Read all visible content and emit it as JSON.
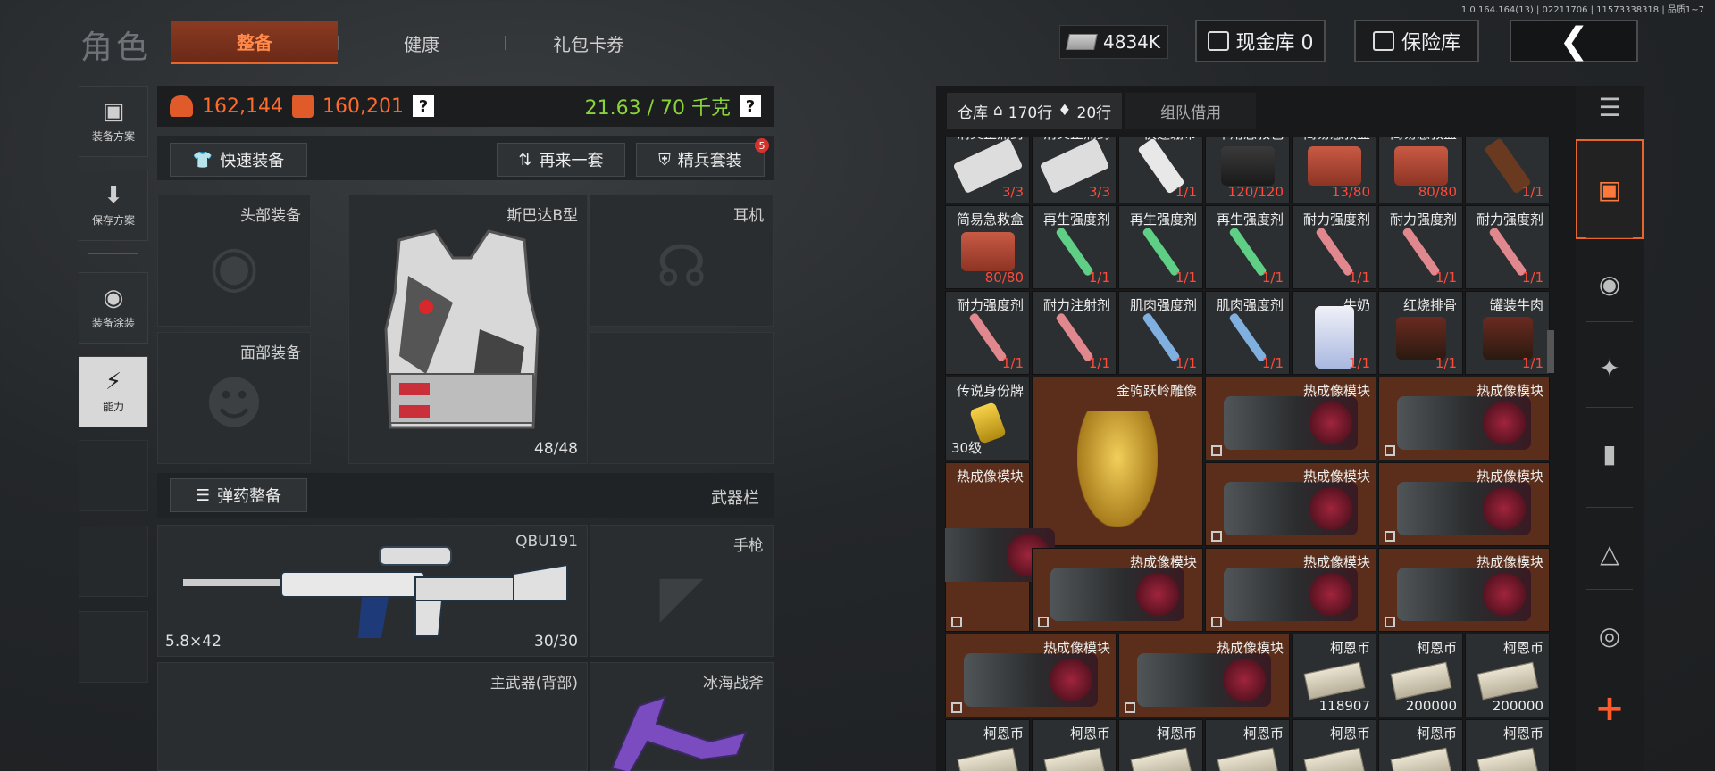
{
  "version": "1.0.164.164(13) | 02211706 | 11573338318 | 品质1~7",
  "header": {
    "title": "角色",
    "tabs": [
      {
        "label": "整备",
        "active": true
      },
      {
        "label": "健康",
        "active": false
      },
      {
        "label": "礼包卡券",
        "active": false
      }
    ],
    "money": "4834K",
    "cash_vault": "现金库 0",
    "safebox": "保险库",
    "back_icon": "chevron-left-icon"
  },
  "rail": {
    "items": [
      {
        "label": "装备方案",
        "icon": "vest-icon"
      },
      {
        "label": "保存方案",
        "icon": "download-icon"
      },
      {
        "label": "装备涂装",
        "icon": "helmet-icon"
      },
      {
        "label": "能力",
        "icon": "lightning-icon",
        "active": true
      }
    ]
  },
  "loadout": {
    "helmet_value": "162,144",
    "armor_value": "160,201",
    "weight": "21.63 / 70 千克",
    "help": "?",
    "quick_equip": "快速装备",
    "again": "再来一套",
    "elite": "精兵套装",
    "elite_badge": "5",
    "ammo_equip": "弹药整备",
    "weapon_bar": "武器栏",
    "slots": {
      "head": "头部装备",
      "face": "面部装备",
      "armor_name": "斯巴达B型",
      "armor_durability": "48/48",
      "headset": "耳机",
      "rifle_name": "QBU191",
      "rifle_caliber": "5.8×42",
      "rifle_ammo": "30/30",
      "pistol": "手枪",
      "primary_back": "主武器(背部)",
      "melee": "冰海战斧"
    }
  },
  "stash": {
    "tab_label": "仓库",
    "rows_a": "170行",
    "rows_b": "20行",
    "team_borrow": "组队借用",
    "colors": {
      "brown": "#5a2e1a",
      "cell": "#2c2f31",
      "red_qty": "#ff4a3a"
    },
    "items": [
      {
        "name": "消炎止痛药",
        "qty": "3/3",
        "red": true,
        "icon": "pills"
      },
      {
        "name": "消炎止痛药",
        "qty": "3/3",
        "red": true,
        "icon": "pills"
      },
      {
        "name": "快速绷带",
        "qty": "1/1",
        "red": true,
        "icon": "bandage"
      },
      {
        "name": "军用急救包",
        "qty": "120/120",
        "red": true,
        "icon": "medkit"
      },
      {
        "name": "简易急救盒",
        "qty": "13/80",
        "red": true,
        "icon": "medbox"
      },
      {
        "name": "简易急救盒",
        "qty": "80/80",
        "red": true,
        "icon": "medbox"
      },
      {
        "name": "",
        "qty": "1/1",
        "red": true,
        "icon": "splint"
      },
      {
        "name": "简易急救盒",
        "qty": "80/80",
        "red": true,
        "icon": "medbox"
      },
      {
        "name": "再生强度剂",
        "qty": "1/1",
        "red": true,
        "icon": "syringe-green"
      },
      {
        "name": "再生强度剂",
        "qty": "1/1",
        "red": true,
        "icon": "syringe-green"
      },
      {
        "name": "再生强度剂",
        "qty": "1/1",
        "red": true,
        "icon": "syringe-green"
      },
      {
        "name": "耐力强度剂",
        "qty": "1/1",
        "red": true,
        "icon": "syringe-pink"
      },
      {
        "name": "耐力强度剂",
        "qty": "1/1",
        "red": true,
        "icon": "syringe-pink"
      },
      {
        "name": "耐力强度剂",
        "qty": "1/1",
        "red": true,
        "icon": "syringe-pink"
      },
      {
        "name": "耐力强度剂",
        "qty": "1/1",
        "red": true,
        "icon": "syringe-pink"
      },
      {
        "name": "耐力注射剂",
        "qty": "1/1",
        "red": true,
        "icon": "syringe-pink"
      },
      {
        "name": "肌肉强度剂",
        "qty": "1/1",
        "red": true,
        "icon": "syringe-blue"
      },
      {
        "name": "肌肉强度剂",
        "qty": "1/1",
        "red": true,
        "icon": "syringe-blue"
      },
      {
        "name": "牛奶",
        "qty": "1/1",
        "red": true,
        "icon": "milk"
      },
      {
        "name": "红烧排骨",
        "qty": "1/1",
        "red": true,
        "icon": "can"
      },
      {
        "name": "罐装牛肉",
        "qty": "1/1",
        "red": true,
        "icon": "can"
      },
      {
        "name": "传说身份牌",
        "level": "30级",
        "icon": "dogtag"
      },
      {
        "name": "金驹跃岭雕像",
        "icon": "horse"
      },
      {
        "name": "热成像模块",
        "icon": "thermal"
      },
      {
        "name": "热成像模块",
        "icon": "thermal"
      },
      {
        "name": "热成像模块",
        "icon": "thermal"
      },
      {
        "name": "热成像模块",
        "icon": "thermal"
      },
      {
        "name": "热成像模块",
        "icon": "thermal"
      },
      {
        "name": "热成像模块",
        "icon": "thermal"
      },
      {
        "name": "热成像模块",
        "icon": "thermal"
      },
      {
        "name": "热成像模块",
        "icon": "thermal"
      },
      {
        "name": "热成像模块",
        "icon": "thermal"
      },
      {
        "name": "热成像模块",
        "icon": "thermal"
      },
      {
        "name": "柯恩币",
        "qty": "118907",
        "icon": "cash"
      },
      {
        "name": "柯恩币",
        "qty": "200000",
        "icon": "cash"
      },
      {
        "name": "柯恩币",
        "qty": "200000",
        "icon": "cash"
      },
      {
        "name": "柯恩币",
        "icon": "cash"
      },
      {
        "name": "柯恩币",
        "icon": "cash"
      },
      {
        "name": "柯恩币",
        "icon": "cash"
      },
      {
        "name": "柯恩币",
        "icon": "cash"
      },
      {
        "name": "柯恩币",
        "icon": "cash"
      },
      {
        "name": "柯恩币",
        "icon": "cash"
      },
      {
        "name": "柯恩币",
        "icon": "cash"
      }
    ]
  },
  "categories": [
    "stack-icon",
    "layers-icon",
    "helmet-icon",
    "rifle-icon",
    "magazine-icon",
    "ammo-icon",
    "scope-icon",
    "plus-icon"
  ]
}
